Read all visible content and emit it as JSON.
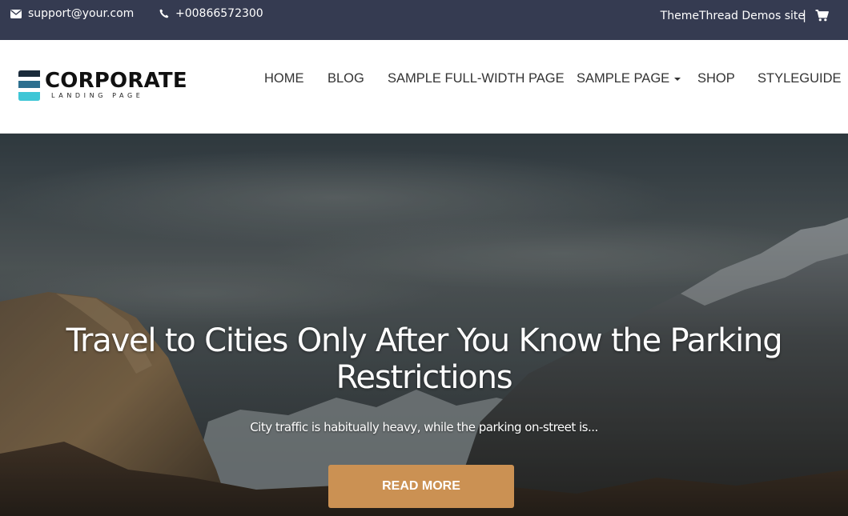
{
  "topbar": {
    "email": "support@your.com",
    "phone": "+00866572300",
    "demos_link": "ThemeThread Demos site",
    "separator": "|",
    "icons": {
      "email": "envelope-icon",
      "phone": "phone-icon",
      "cart": "shopping-cart-icon"
    }
  },
  "header": {
    "logo": {
      "brand": "CORPORATE",
      "tagline": "LANDING PAGE",
      "colors": [
        "#1a2a3a",
        "#2d6f8f",
        "#3ec6d6"
      ]
    },
    "nav": [
      {
        "label": "HOME"
      },
      {
        "label": "BLOG"
      },
      {
        "label": "SAMPLE FULL-WIDTH PAGE"
      },
      {
        "label": "SAMPLE PAGE",
        "has_dropdown": true
      },
      {
        "label": "SHOP"
      },
      {
        "label": "STYLEGUIDE"
      }
    ]
  },
  "hero": {
    "title": "Travel to Cities Only After You Know the Parking Restrictions",
    "subtitle": "City traffic is habitually heavy, while the parking on-street is...",
    "button_label": "READ MORE",
    "button_color": "#cb9153"
  },
  "colors": {
    "topbar_bg": "#353b51"
  }
}
